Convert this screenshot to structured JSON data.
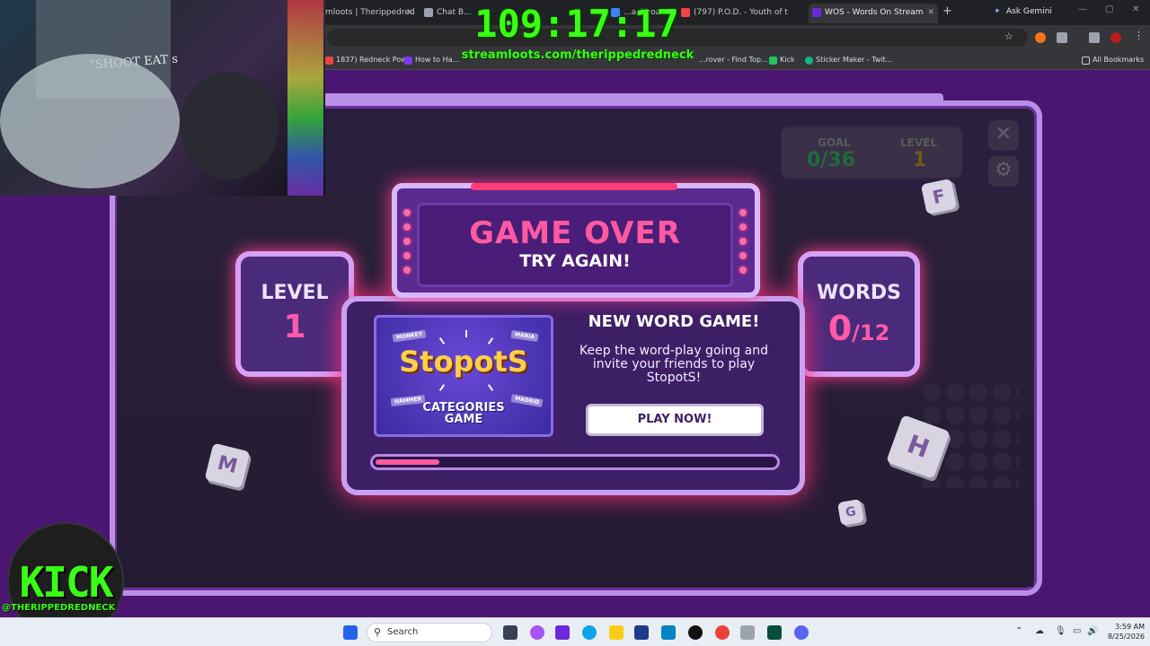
{
  "browser": {
    "tabs": [
      {
        "label": "mloots | Therippedred",
        "color": "#f59e0b"
      },
      {
        "label": "Chat B...",
        "color": "#9ca3af"
      },
      {
        "label": "...ashboard",
        "color": "#3b82f6"
      },
      {
        "label": "(797) P.O.D. - Youth of t",
        "color": "#ef4444"
      },
      {
        "label": "WOS - Words On Stream",
        "color": "#6d28d9",
        "active": true
      }
    ],
    "ask_gemini": "Ask Gemini",
    "bookmarks": [
      {
        "label": "1837) Redneck Pow...",
        "color": "#ef4444"
      },
      {
        "label": "How to Ha...",
        "color": "#7c3aed"
      },
      {
        "label": "...rover - Find Top...",
        "color": "#22c55e"
      },
      {
        "label": "Kick",
        "color": "#22c55e"
      },
      {
        "label": "Sticker Maker - Twit...",
        "color": "#10b981"
      }
    ],
    "all_bookmarks": "All Bookmarks"
  },
  "game": {
    "hud": {
      "goal_label": "GOAL",
      "goal_value": "0/36",
      "level_label": "LEVEL",
      "level_value": "1",
      "close_icon": "close-icon",
      "settings_icon": "gear-icon"
    },
    "cubes": [
      "F",
      "M",
      "H",
      "G"
    ],
    "modal": {
      "title": "GAME OVER",
      "subtitle": "TRY AGAIN!",
      "level_label": "LEVEL",
      "level_value": "1",
      "words_label": "WORDS",
      "words_value": "0",
      "words_total": "/12",
      "promo": {
        "logo": "StopotS",
        "line1": "CATEGORIES",
        "line2": "GAME",
        "tags": [
          "MONKEY",
          "MARIA",
          "HAMMER",
          "MADRID"
        ]
      },
      "promo_title": "NEW WORD GAME!",
      "promo_desc": "Keep the word-play going and invite your friends to play StopotS!",
      "play_button": "PLAY NOW!",
      "progress": 0.16
    }
  },
  "overlay": {
    "timer": "109:17:17",
    "streamloots": "streamloots.com/therippedredneck",
    "shirt_text": "\"SHOOT EAT s",
    "kick": "KICK",
    "kick_handle": "@THERIPPEDREDNECK"
  },
  "taskbar": {
    "search_placeholder": "Search",
    "time": "3:59 AM",
    "date": "8/25/2026"
  },
  "colors": {
    "accent_pink": "#ff5aa0",
    "stream_green": "#39ff14",
    "purple_bg": "#4b1672"
  }
}
